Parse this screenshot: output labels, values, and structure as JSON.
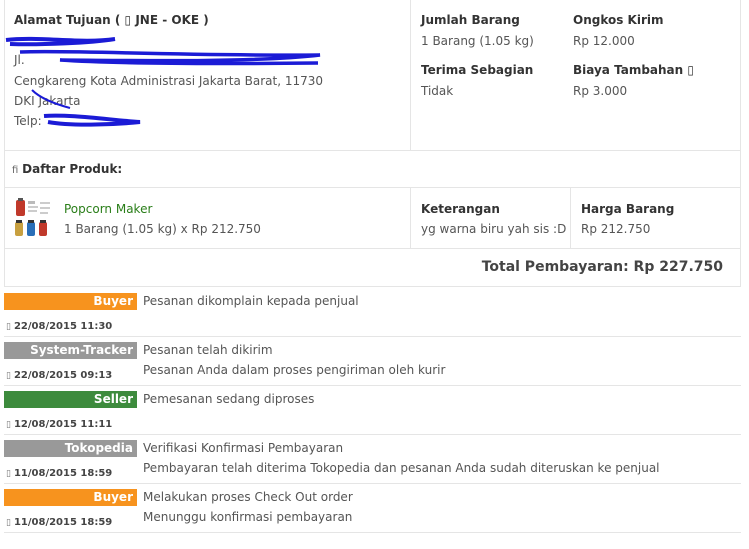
{
  "address": {
    "heading": "Alamat Tujuan ( ▯ JNE - OKE )",
    "line_street_prefix": "Jl. ",
    "line_city": "Cengkareng Kota Administrasi Jakarta Barat, 11730",
    "line_province": "DKI Jakarta",
    "phone_label": "Telp: "
  },
  "summary": {
    "qty_label": "Jumlah Barang",
    "qty_value": "1 Barang (1.05 kg)",
    "shipping_label": "Ongkos Kirim",
    "shipping_value": "Rp 12.000",
    "partial_label": "Terima Sebagian",
    "partial_value": "Tidak",
    "extra_label": "Biaya Tambahan ▯",
    "extra_value": "Rp 3.000"
  },
  "products": {
    "heading_icon": "fi",
    "heading": "Daftar Produk:",
    "items": [
      {
        "name": "Popcorn Maker",
        "detail": "1 Barang (1.05 kg) x Rp 212.750",
        "note_label": "Keterangan",
        "note_value": "yg warna biru yah sis :D",
        "price_label": "Harga Barang",
        "price_value": "Rp 212.750",
        "icon": "popcorn-maker-thumbnail"
      }
    ],
    "total": "Total Pembayaran: Rp 227.750"
  },
  "timeline": [
    {
      "actor": "Buyer",
      "color": "#f7931e",
      "lines": [
        "Pesanan dikomplain kepada penjual"
      ],
      "date": "22/08/2015 11:30"
    },
    {
      "actor": "System-Tracker",
      "color": "#999999",
      "lines": [
        "Pesanan telah dikirim",
        "Pesanan Anda dalam proses pengiriman oleh kurir"
      ],
      "date": "22/08/2015 09:13"
    },
    {
      "actor": "Seller",
      "color": "#3d8b3d",
      "lines": [
        "Pemesanan sedang diproses"
      ],
      "date": "12/08/2015 11:11"
    },
    {
      "actor": "Tokopedia",
      "color": "#999999",
      "lines": [
        "Verifikasi Konfirmasi Pembayaran",
        "Pembayaran telah diterima Tokopedia dan pesanan Anda sudah diteruskan ke penjual"
      ],
      "date": "11/08/2015 18:59"
    },
    {
      "actor": "Buyer",
      "color": "#f7931e",
      "lines": [
        "Melakukan proses Check Out order",
        "Menunggu konfirmasi pembayaran"
      ],
      "date": "11/08/2015 18:59"
    }
  ],
  "icons": {
    "clock": "clock-icon"
  },
  "date_icon_glyph": "▯"
}
